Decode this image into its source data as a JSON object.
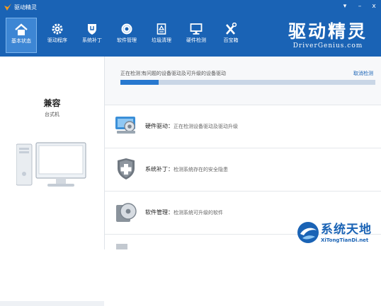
{
  "titlebar": {
    "title": "驱动精灵",
    "menu": "▾",
    "minimize": "–",
    "close": "x"
  },
  "nav": [
    {
      "label": "基本状态",
      "icon": "home-icon",
      "active": true
    },
    {
      "label": "驱动程序",
      "icon": "gear-icon"
    },
    {
      "label": "系统补丁",
      "icon": "shield-icon"
    },
    {
      "label": "软件管理",
      "icon": "disc-icon"
    },
    {
      "label": "垃圾清理",
      "icon": "recycle-icon"
    },
    {
      "label": "硬件检测",
      "icon": "monitor-icon"
    },
    {
      "label": "百宝箱",
      "icon": "tools-icon"
    }
  ],
  "brand": {
    "cn": "驱动精灵",
    "en": "DriverGenius.com"
  },
  "left": {
    "compat": "兼容",
    "device_type": "台式机"
  },
  "scan": {
    "label": "正在检测：",
    "text": "有问题的设备驱动及可升级的设备驱动",
    "cancel": "取消检测",
    "progress": 0.15
  },
  "rows": [
    {
      "title": "硬件驱动：",
      "status": "正在检测设备驱动及驱动升级",
      "icon": "hardware-driver-icon"
    },
    {
      "title": "系统补丁：",
      "status": "检测系统存在的安全隐患",
      "icon": "patch-shield-icon"
    },
    {
      "title": "软件管理：",
      "status": "检测系统可升级的软件",
      "icon": "software-disc-icon"
    }
  ],
  "watermark": {
    "cn": "系统天地",
    "en": "XiTongTianDi.net"
  },
  "colors": {
    "accent": "#1a63b5",
    "progress_fill": "#2778cf",
    "progress_track": "#c9d6e6"
  }
}
